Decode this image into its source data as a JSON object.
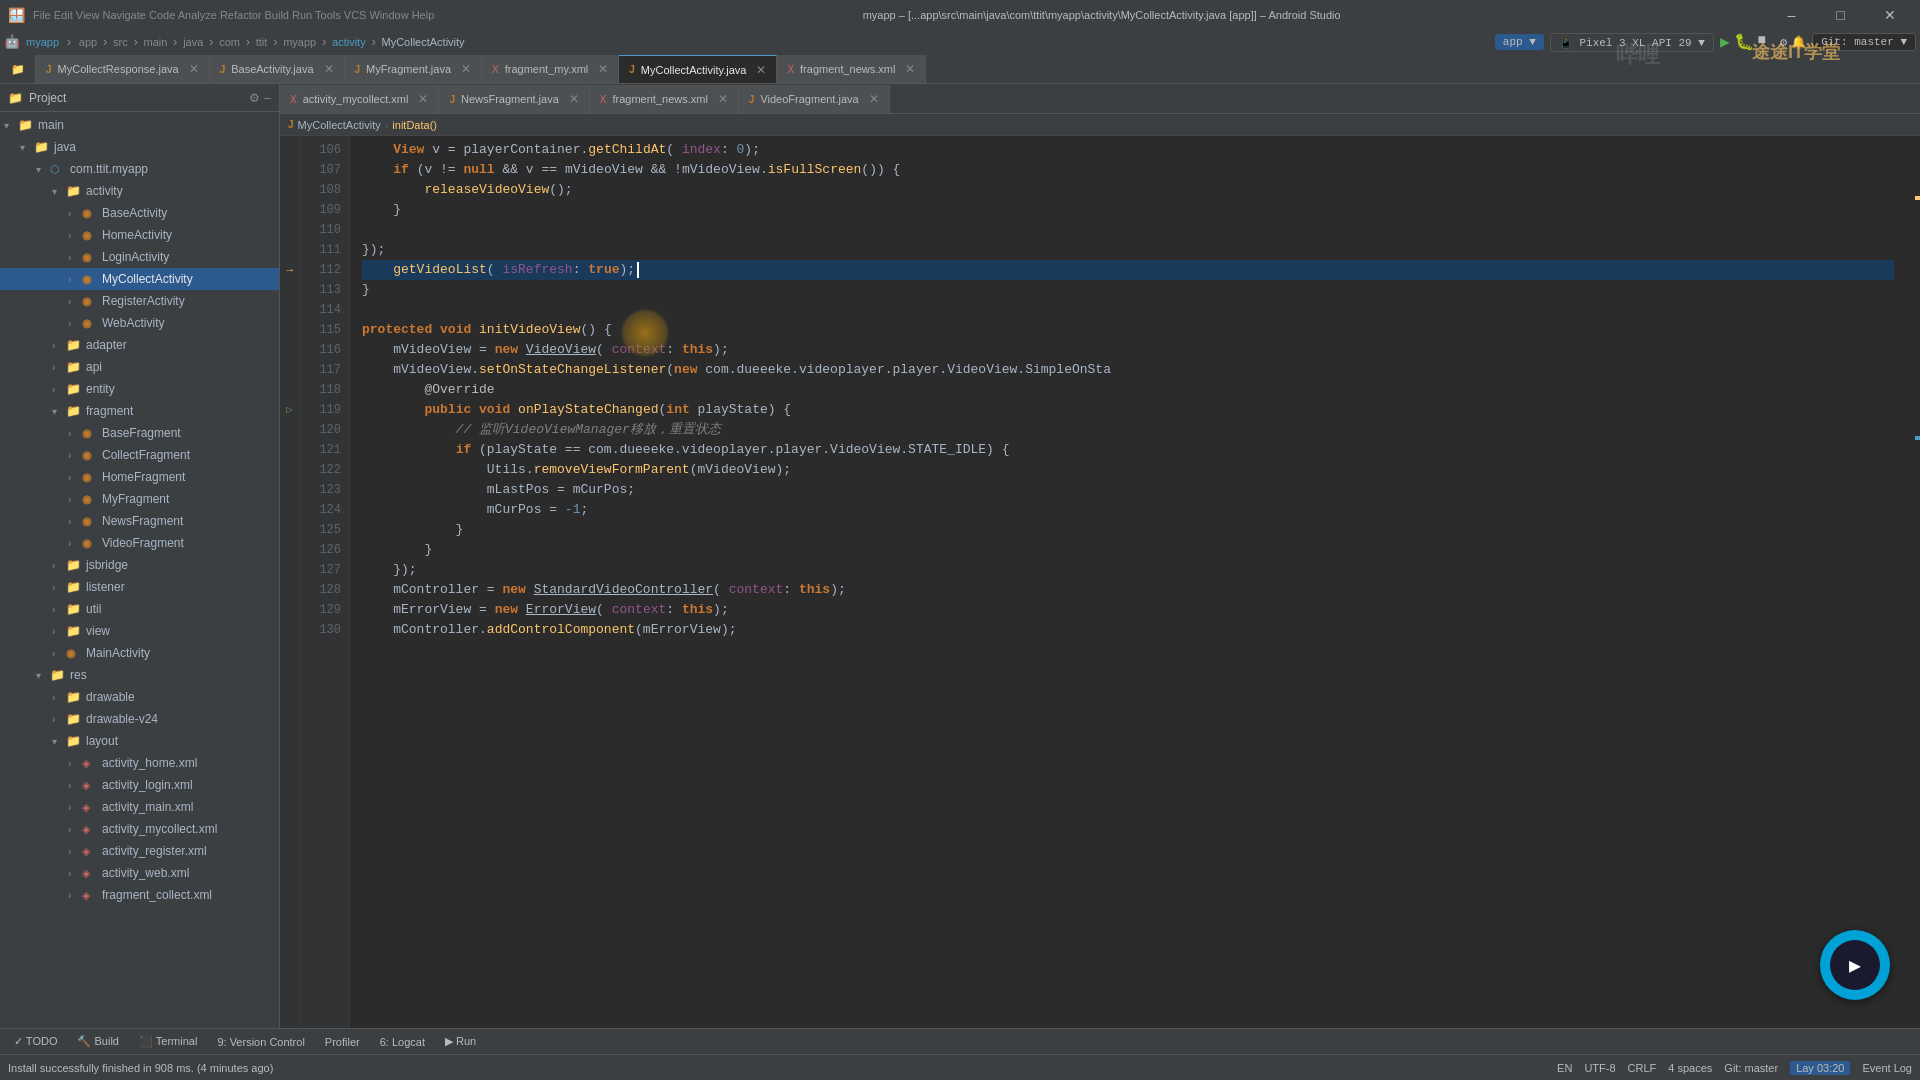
{
  "window": {
    "title": "myapp – [...app\\src\\main\\java\\com\\ttit\\myapp\\activity\\MyCollectActivity.java [app]] – Android Studio",
    "controls": [
      "–",
      "□",
      "✕"
    ]
  },
  "menu": {
    "items": [
      "File",
      "Edit",
      "View",
      "Navigate",
      "Code",
      "Analyze",
      "Refactor",
      "Build",
      "Run",
      "Tools",
      "VCS",
      "Window",
      "Help"
    ]
  },
  "breadcrumb": {
    "items": [
      "myapp",
      "app",
      "src",
      "main",
      "java",
      "com",
      "ttit",
      "myapp",
      "activity",
      "MyCollectActivity"
    ]
  },
  "tabs_row1": [
    {
      "label": "MyCollectResponse.java",
      "type": "java",
      "active": false
    },
    {
      "label": "BaseActivity.java",
      "type": "java",
      "active": false
    },
    {
      "label": "MyFragment.java",
      "type": "java",
      "active": false
    },
    {
      "label": "fragment_my.xml",
      "type": "xml",
      "active": false
    },
    {
      "label": "MyCollectActivity.java",
      "type": "java",
      "active": true
    },
    {
      "label": "fragment_news.xml",
      "type": "xml",
      "active": false
    }
  ],
  "tabs_row2": [
    {
      "label": "activity_mycollect.xml",
      "type": "xml",
      "active": false
    },
    {
      "label": "NewsFragment.java",
      "type": "java",
      "active": false
    },
    {
      "label": "fragment_news.xml",
      "type": "xml",
      "active": false
    },
    {
      "label": "VideoFragment.java",
      "type": "java",
      "active": false
    }
  ],
  "project": {
    "header": "Project",
    "tree": [
      {
        "level": 0,
        "icon": "folder",
        "label": "main",
        "expanded": true
      },
      {
        "level": 1,
        "icon": "folder",
        "label": "java",
        "expanded": true
      },
      {
        "level": 2,
        "icon": "package",
        "label": "com.ttit.myapp",
        "expanded": true
      },
      {
        "level": 3,
        "icon": "folder",
        "label": "activity",
        "expanded": true
      },
      {
        "level": 4,
        "icon": "java",
        "label": "BaseActivity",
        "expanded": false
      },
      {
        "level": 4,
        "icon": "java",
        "label": "HomeActivity",
        "expanded": false
      },
      {
        "level": 4,
        "icon": "java",
        "label": "LoginActivity",
        "expanded": false
      },
      {
        "level": 4,
        "icon": "java",
        "label": "MyCollectActivity",
        "expanded": false,
        "selected": true
      },
      {
        "level": 4,
        "icon": "java",
        "label": "RegisterActivity",
        "expanded": false
      },
      {
        "level": 4,
        "icon": "java",
        "label": "WebActivity",
        "expanded": false
      },
      {
        "level": 3,
        "icon": "folder",
        "label": "adapter",
        "expanded": false
      },
      {
        "level": 3,
        "icon": "folder",
        "label": "api",
        "expanded": false
      },
      {
        "level": 3,
        "icon": "folder",
        "label": "entity",
        "expanded": false
      },
      {
        "level": 3,
        "icon": "folder",
        "label": "fragment",
        "expanded": true
      },
      {
        "level": 4,
        "icon": "java",
        "label": "BaseFragment",
        "expanded": false
      },
      {
        "level": 4,
        "icon": "java",
        "label": "CollectFragment",
        "expanded": false
      },
      {
        "level": 4,
        "icon": "java",
        "label": "HomeFragment",
        "expanded": false
      },
      {
        "level": 4,
        "icon": "java",
        "label": "MyFragment",
        "expanded": false
      },
      {
        "level": 4,
        "icon": "java",
        "label": "NewsFragment",
        "expanded": false
      },
      {
        "level": 4,
        "icon": "java",
        "label": "VideoFragment",
        "expanded": false
      },
      {
        "level": 3,
        "icon": "folder",
        "label": "jsbridge",
        "expanded": false
      },
      {
        "level": 3,
        "icon": "folder",
        "label": "listener",
        "expanded": false
      },
      {
        "level": 3,
        "icon": "folder",
        "label": "util",
        "expanded": false
      },
      {
        "level": 3,
        "icon": "folder",
        "label": "view",
        "expanded": false
      },
      {
        "level": 3,
        "icon": "java",
        "label": "MainActivity",
        "expanded": false
      },
      {
        "level": 2,
        "icon": "folder",
        "label": "res",
        "expanded": true
      },
      {
        "level": 3,
        "icon": "folder",
        "label": "drawable",
        "expanded": false
      },
      {
        "level": 3,
        "icon": "folder",
        "label": "drawable-v24",
        "expanded": false
      },
      {
        "level": 3,
        "icon": "folder",
        "label": "layout",
        "expanded": true
      },
      {
        "level": 4,
        "icon": "xml",
        "label": "activity_home.xml",
        "expanded": false
      },
      {
        "level": 4,
        "icon": "xml",
        "label": "activity_login.xml",
        "expanded": false
      },
      {
        "level": 4,
        "icon": "xml",
        "label": "activity_main.xml",
        "expanded": false
      },
      {
        "level": 4,
        "icon": "xml",
        "label": "activity_mycollect.xml",
        "expanded": false
      },
      {
        "level": 4,
        "icon": "xml",
        "label": "activity_register.xml",
        "expanded": false
      },
      {
        "level": 4,
        "icon": "xml",
        "label": "activity_web.xml",
        "expanded": false
      },
      {
        "level": 4,
        "icon": "xml",
        "label": "fragment_collect.xml",
        "expanded": false
      }
    ]
  },
  "code": {
    "lines": [
      {
        "num": 106,
        "content": "    View v = playerContainer.getChildAt( index: 0);",
        "tokens": [
          {
            "t": "kw",
            "v": "    View"
          },
          {
            "t": "var",
            "v": " v = "
          },
          {
            "t": "var",
            "v": "playerContainer"
          },
          {
            "t": "punct",
            "v": "."
          },
          {
            "t": "method",
            "v": "getChildAt"
          },
          {
            "t": "var",
            "v": "( "
          },
          {
            "t": "param",
            "v": "index"
          },
          {
            "t": "var",
            "v": ": "
          },
          {
            "t": "number",
            "v": "0"
          },
          {
            "t": "var",
            "v": ");"
          }
        ]
      },
      {
        "num": 107,
        "content": "    if (v != null && v == mVideoView && !mVideoView.isFullScreen()) {",
        "tokens": [
          {
            "t": "var",
            "v": "    "
          },
          {
            "t": "kw",
            "v": "if"
          },
          {
            "t": "var",
            "v": " (v != "
          },
          {
            "t": "kw",
            "v": "null"
          },
          {
            "t": "var",
            "v": " && v == "
          },
          {
            "t": "var",
            "v": "mVideoView"
          },
          {
            "t": "var",
            "v": " && !"
          },
          {
            "t": "var",
            "v": "mVideoView"
          },
          {
            "t": "punct",
            "v": "."
          },
          {
            "t": "method",
            "v": "isFullScreen"
          },
          {
            "t": "var",
            "v": "()) {"
          }
        ]
      },
      {
        "num": 108,
        "content": "        releaseVideoView();",
        "tokens": [
          {
            "t": "var",
            "v": "        "
          },
          {
            "t": "method",
            "v": "releaseVideoView"
          },
          {
            "t": "var",
            "v": "();"
          }
        ]
      },
      {
        "num": 109,
        "content": "    }",
        "tokens": [
          {
            "t": "var",
            "v": "    }"
          }
        ]
      },
      {
        "num": 110,
        "content": "",
        "tokens": []
      },
      {
        "num": 111,
        "content": "});",
        "tokens": [
          {
            "t": "var",
            "v": "});"
          }
        ]
      },
      {
        "num": 112,
        "content": "    getVideoList( isRefresh: true);",
        "tokens": [
          {
            "t": "var",
            "v": "    "
          },
          {
            "t": "method",
            "v": "getVideoList"
          },
          {
            "t": "var",
            "v": "( "
          },
          {
            "t": "param",
            "v": "isRefresh"
          },
          {
            "t": "var",
            "v": ": "
          },
          {
            "t": "kw",
            "v": "true"
          },
          {
            "t": "var",
            "v": ");"
          }
        ],
        "highlight": true
      },
      {
        "num": 113,
        "content": "}",
        "tokens": [
          {
            "t": "var",
            "v": "}"
          }
        ]
      },
      {
        "num": 114,
        "content": "",
        "tokens": []
      },
      {
        "num": 115,
        "content": "protected void initVideoView() {",
        "tokens": [
          {
            "t": "kw",
            "v": "protected"
          },
          {
            "t": "var",
            "v": " "
          },
          {
            "t": "kw",
            "v": "void"
          },
          {
            "t": "var",
            "v": " "
          },
          {
            "t": "method",
            "v": "initVideoView"
          },
          {
            "t": "var",
            "v": "() {"
          }
        ]
      },
      {
        "num": 116,
        "content": "    mVideoView = new VideoView( context: this);",
        "tokens": [
          {
            "t": "var",
            "v": "    mVideoView = "
          },
          {
            "t": "kw",
            "v": "new"
          },
          {
            "t": "var",
            "v": " "
          },
          {
            "t": "class-name",
            "v": "VideoView"
          },
          {
            "t": "var",
            "v": "( "
          },
          {
            "t": "param",
            "v": "context"
          },
          {
            "t": "var",
            "v": ": "
          },
          {
            "t": "kw",
            "v": "this"
          },
          {
            "t": "var",
            "v": ");"
          }
        ]
      },
      {
        "num": 117,
        "content": "    mVideoView.setOnStateChangeListener(new com.dueeeke.videoplayer.player.VideoView.SimpleOnSta",
        "tokens": [
          {
            "t": "var",
            "v": "    mVideoView."
          },
          {
            "t": "method",
            "v": "setOnStateChangeListener"
          },
          {
            "t": "var",
            "v": "("
          },
          {
            "t": "kw",
            "v": "new"
          },
          {
            "t": "var",
            "v": " com.dueeeke.videoplayer.player.VideoView.SimpleOnSta"
          }
        ]
      },
      {
        "num": 118,
        "content": "        @Override",
        "tokens": [
          {
            "t": "annotation",
            "v": "        @Override"
          }
        ]
      },
      {
        "num": 119,
        "content": "        public void onPlayStateChanged(int playState) {",
        "tokens": [
          {
            "t": "var",
            "v": "        "
          },
          {
            "t": "kw",
            "v": "public"
          },
          {
            "t": "var",
            "v": " "
          },
          {
            "t": "kw",
            "v": "void"
          },
          {
            "t": "var",
            "v": " "
          },
          {
            "t": "method",
            "v": "onPlayStateChanged"
          },
          {
            "t": "var",
            "v": "("
          },
          {
            "t": "kw",
            "v": "int"
          },
          {
            "t": "var",
            "v": " playState) {"
          }
        ]
      },
      {
        "num": 120,
        "content": "            // 监听VideoViewManager移放，重置状态",
        "tokens": [
          {
            "t": "comment",
            "v": "            // 监听VideoViewManager移放，重置状态"
          }
        ]
      },
      {
        "num": 121,
        "content": "            if (playState == com.dueeeke.videoplayer.player.VideoView.STATE_IDLE) {",
        "tokens": [
          {
            "t": "var",
            "v": "            "
          },
          {
            "t": "kw",
            "v": "if"
          },
          {
            "t": "var",
            "v": " (playState == com.dueeeke.videoplayer.player.VideoView.STATE_IDLE) {"
          }
        ]
      },
      {
        "num": 122,
        "content": "                Utils.removeViewFormParent(mVideoView);",
        "tokens": [
          {
            "t": "var",
            "v": "                Utils."
          },
          {
            "t": "method",
            "v": "removeViewFormParent"
          },
          {
            "t": "var",
            "v": "(mVideoView);"
          }
        ]
      },
      {
        "num": 123,
        "content": "                mLastPos = mCurPos;",
        "tokens": [
          {
            "t": "var",
            "v": "                mLastPos = mCurPos;"
          }
        ]
      },
      {
        "num": 124,
        "content": "                mCurPos = -1;",
        "tokens": [
          {
            "t": "var",
            "v": "                mCurPos = "
          },
          {
            "t": "number",
            "v": "-1"
          },
          {
            "t": "var",
            "v": ";"
          }
        ]
      },
      {
        "num": 125,
        "content": "            }",
        "tokens": [
          {
            "t": "var",
            "v": "            }"
          }
        ]
      },
      {
        "num": 126,
        "content": "        }",
        "tokens": [
          {
            "t": "var",
            "v": "        }"
          }
        ]
      },
      {
        "num": 127,
        "content": "    });",
        "tokens": [
          {
            "t": "var",
            "v": "    });"
          }
        ]
      },
      {
        "num": 128,
        "content": "    mController = new StandardVideoController( context: this);",
        "tokens": [
          {
            "t": "var",
            "v": "    mController = "
          },
          {
            "t": "kw",
            "v": "new"
          },
          {
            "t": "var",
            "v": " "
          },
          {
            "t": "class-name",
            "v": "StandardVideoController"
          },
          {
            "t": "var",
            "v": "( "
          },
          {
            "t": "param",
            "v": "context"
          },
          {
            "t": "var",
            "v": ": "
          },
          {
            "t": "kw",
            "v": "this"
          },
          {
            "t": "var",
            "v": ");"
          }
        ]
      },
      {
        "num": 129,
        "content": "    mErrorView = new ErrorView( context: this);",
        "tokens": [
          {
            "t": "var",
            "v": "    mErrorView = "
          },
          {
            "t": "kw",
            "v": "new"
          },
          {
            "t": "var",
            "v": " "
          },
          {
            "t": "class-name",
            "v": "ErrorView"
          },
          {
            "t": "var",
            "v": "( "
          },
          {
            "t": "param",
            "v": "context"
          },
          {
            "t": "var",
            "v": ": "
          },
          {
            "t": "kw",
            "v": "this"
          },
          {
            "t": "var",
            "v": ");"
          }
        ]
      },
      {
        "num": 130,
        "content": "    mController.addControlComponent(mErrorView);",
        "tokens": [
          {
            "t": "var",
            "v": "    mController."
          },
          {
            "t": "method",
            "v": "addControlComponent"
          },
          {
            "t": "var",
            "v": "(mErrorView);"
          }
        ]
      }
    ]
  },
  "editor_breadcrumb": {
    "items": [
      "MyCollectActivity",
      "initData()"
    ]
  },
  "bottom_tabs": [
    {
      "label": "TODO",
      "active": false
    },
    {
      "label": "Build",
      "active": false
    },
    {
      "label": "Terminal",
      "active": false
    },
    {
      "label": "9: Version Control",
      "active": false
    },
    {
      "label": "Profiler",
      "active": false
    },
    {
      "label": "6: Logcat",
      "active": false
    },
    {
      "label": "Run",
      "active": false
    }
  ],
  "status_bar": {
    "message": "Install successfully finished in 908 ms. (4 minutes ago)",
    "right_items": [
      "EN",
      "UTF-8",
      "CRLF",
      "4 spaces",
      "Git: master",
      "Lay 03:20"
    ]
  },
  "device": "Pixel 3 XL API 29",
  "git_branch": "Git: master"
}
